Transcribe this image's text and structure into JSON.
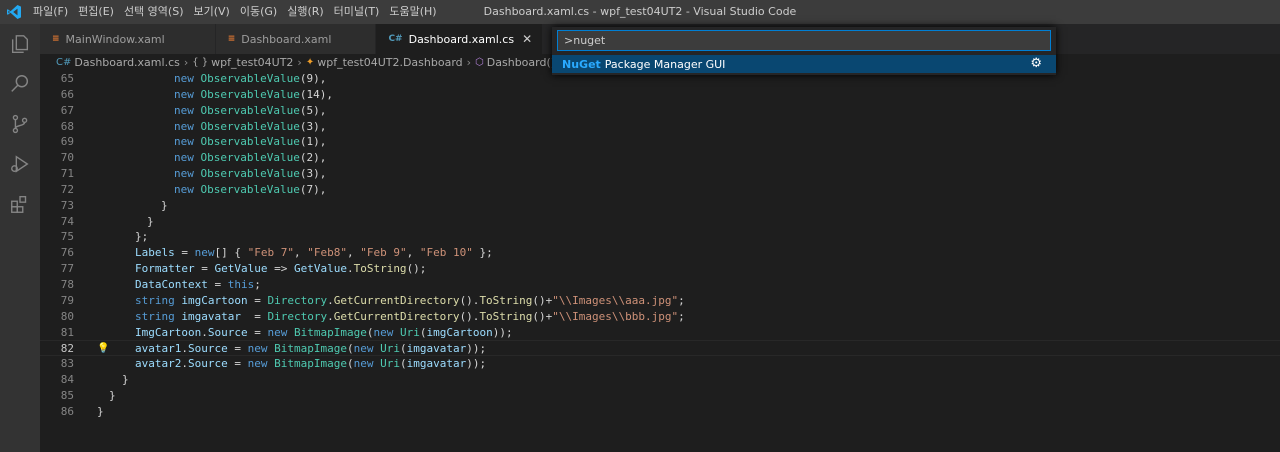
{
  "titlebar": {
    "menu": [
      "파일(F)",
      "편집(E)",
      "선택 영역(S)",
      "보기(V)",
      "이동(G)",
      "실행(R)",
      "터미널(T)",
      "도움말(H)"
    ],
    "window_title": "Dashboard.xaml.cs - wpf_test04UT2 - Visual Studio Code"
  },
  "tabs": [
    {
      "label": "MainWindow.xaml",
      "icon": "rss-icon"
    },
    {
      "label": "Dashboard.xaml",
      "icon": "rss-icon"
    },
    {
      "label": "Dashboard.xaml.cs",
      "icon": "csharp-icon",
      "close": "✕"
    }
  ],
  "breadcrumb": {
    "file": "Dashboard.xaml.cs",
    "namespace_icon": "{ }",
    "namespace": "wpf_test04UT2",
    "class": "wpf_test04UT2.Dashboard",
    "method": "Dashboard()"
  },
  "palette": {
    "input_value": ">nuget",
    "result_highlight": "NuGet",
    "result_rest": "Package Manager GUI"
  },
  "editor": {
    "current_line": 82,
    "lines": [
      {
        "n": "65",
        "code": "new ObservableValue(9),"
      },
      {
        "n": "66",
        "code": "new ObservableValue(14),"
      },
      {
        "n": "67",
        "code": "new ObservableValue(5),"
      },
      {
        "n": "68",
        "code": "new ObservableValue(3),"
      },
      {
        "n": "69",
        "code": "new ObservableValue(1),"
      },
      {
        "n": "70",
        "code": "new ObservableValue(2),"
      },
      {
        "n": "71",
        "code": "new ObservableValue(3),"
      },
      {
        "n": "72",
        "code": "new ObservableValue(7),"
      },
      {
        "n": "73",
        "code": "}"
      },
      {
        "n": "74",
        "code": "}"
      },
      {
        "n": "75",
        "code": "};"
      },
      {
        "n": "76",
        "code": "Labels = new[] { \"Feb 7\", \"Feb8\", \"Feb 9\", \"Feb 10\" };"
      },
      {
        "n": "77",
        "code": "Formatter = GetValue => GetValue.ToString();"
      },
      {
        "n": "78",
        "code": "DataContext = this;"
      },
      {
        "n": "79",
        "code": "string imgCartoon = Directory.GetCurrentDirectory().ToString()+\"\\\\Images\\\\aaa.jpg\";"
      },
      {
        "n": "80",
        "code": "string imgavatar  = Directory.GetCurrentDirectory().ToString()+\"\\\\Images\\\\bbb.jpg\";"
      },
      {
        "n": "81",
        "code": "ImgCartoon.Source = new BitmapImage(new Uri(imgCartoon));"
      },
      {
        "n": "82",
        "code": "avatar1.Source = new BitmapImage(new Uri(imgavatar));"
      },
      {
        "n": "83",
        "code": "avatar2.Source = new BitmapImage(new Uri(imgavatar));"
      },
      {
        "n": "84",
        "code": "}"
      },
      {
        "n": "85",
        "code": "}"
      },
      {
        "n": "86",
        "code": "}"
      }
    ]
  }
}
